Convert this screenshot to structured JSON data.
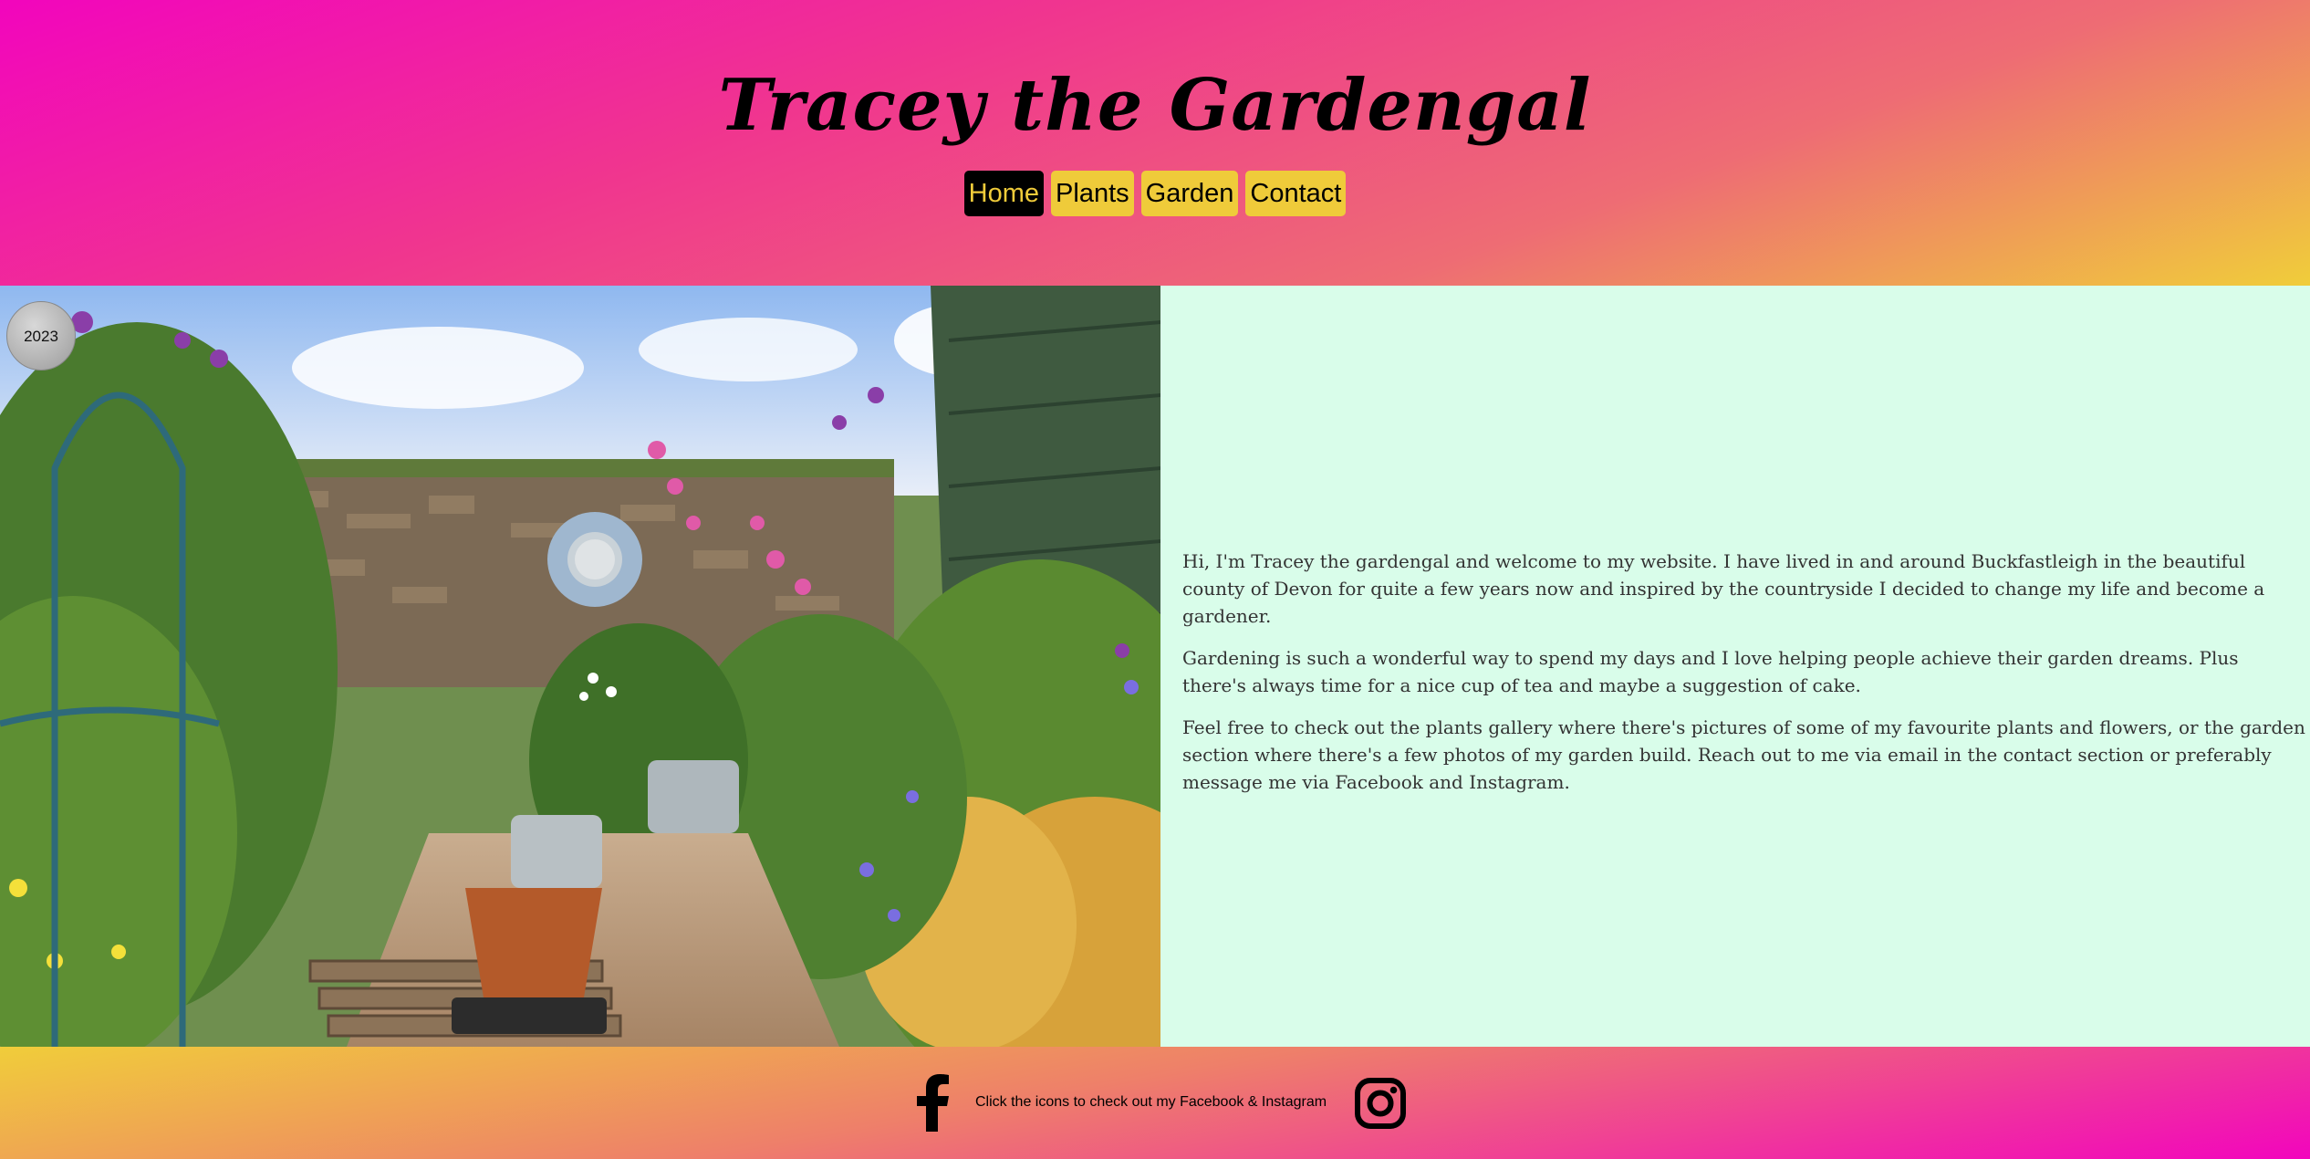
{
  "header": {
    "title": "Tracey the Gardengal",
    "nav": [
      {
        "label": "Home",
        "active": true
      },
      {
        "label": "Plants",
        "active": false
      },
      {
        "label": "Garden",
        "active": false
      },
      {
        "label": "Contact",
        "active": false
      }
    ]
  },
  "hero": {
    "year_badge": "2023",
    "image_icon": "garden-photo"
  },
  "intro": {
    "paragraphs": [
      "Hi, I'm Tracey the gardengal and welcome to my website. I have lived in and around Buckfastleigh in the beautiful county of Devon for quite a few years now and inspired by the countryside I decided to change my life and become a gardener.",
      "Gardening is such a wonderful way to spend my days and I love helping people achieve their garden dreams. Plus there's always time for a nice cup of tea and maybe a suggestion of cake.",
      "Feel free to check out the plants gallery where there's pictures of some of my favourite plants and flowers, or the garden section where there's a few photos of my garden build. Reach out to me via email in the contact section or preferably message me via Facebook and Instagram."
    ]
  },
  "footer": {
    "text": "Click the icons to check out my Facebook & Instagram",
    "icons": [
      "facebook-icon",
      "instagram-icon"
    ]
  },
  "colors": {
    "accent_yellow": "#efcb3a",
    "accent_pink": "#f205bd",
    "panel_mint": "#d9fdea"
  }
}
